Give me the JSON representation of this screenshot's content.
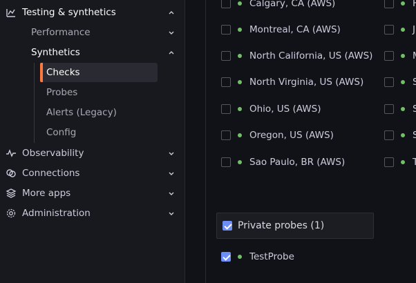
{
  "sidebar": {
    "testing": {
      "label": "Testing & synthetics",
      "icon": "testing-icon"
    },
    "performance": {
      "label": "Performance"
    },
    "synthetics": {
      "label": "Synthetics"
    },
    "synthetics_children": [
      {
        "label": "Checks",
        "selected": true
      },
      {
        "label": "Probes"
      },
      {
        "label": "Alerts (Legacy)"
      },
      {
        "label": "Config"
      }
    ],
    "observability": {
      "label": "Observability",
      "icon": "pulse-icon"
    },
    "connections": {
      "label": "Connections",
      "icon": "connections-icon"
    },
    "more_apps": {
      "label": "More apps",
      "icon": "layers-icon"
    },
    "administration": {
      "label": "Administration",
      "icon": "gear-icon"
    }
  },
  "probes": {
    "col1": [
      {
        "label": "Calgary, CA (AWS)"
      },
      {
        "label": "Montreal, CA (AWS)"
      },
      {
        "label": "North California, US (AWS)"
      },
      {
        "label": "North Virginia, US (AWS)"
      },
      {
        "label": "Ohio, US (AWS)"
      },
      {
        "label": "Oregon, US (AWS)"
      },
      {
        "label": "Sao Paulo, BR (AWS)"
      }
    ],
    "col2": [
      {
        "label": "H"
      },
      {
        "label": "J"
      },
      {
        "label": "M"
      },
      {
        "label": "S"
      },
      {
        "label": "S"
      },
      {
        "label": "S"
      },
      {
        "label": "T"
      }
    ],
    "private_section": {
      "label": "Private probes (1)",
      "checked": true
    },
    "private_items": [
      {
        "label": "TestProbe",
        "checked": true
      }
    ]
  },
  "colors": {
    "accent": "#ff7941",
    "online": "#73bf69",
    "checkbox_checked": "#6e8ef5"
  }
}
